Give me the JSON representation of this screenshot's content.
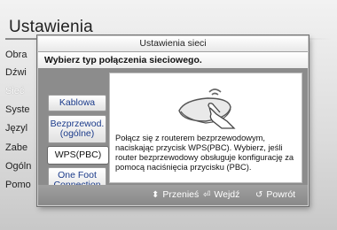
{
  "screen": {
    "title": "Ustawienia"
  },
  "side_menu": {
    "items": [
      {
        "label": "Obra"
      },
      {
        "label": "Dźwi"
      },
      {
        "label": "Sieć"
      },
      {
        "label": "Syste"
      },
      {
        "label": "Języl"
      },
      {
        "label": "Zabe"
      },
      {
        "label": "Ogóln"
      },
      {
        "label": "Pomo"
      }
    ],
    "active_index": 2
  },
  "dialog": {
    "header": "Ustawienia sieci",
    "subtitle": "Wybierz typ połączenia sieciowego.",
    "options": [
      {
        "label": "Kablowa",
        "selected": false
      },
      {
        "label": "Bezprzewod. (ogólne)",
        "selected": false
      },
      {
        "label": "WPS(PBC)",
        "selected": true
      },
      {
        "label": "One Foot Connection",
        "selected": false
      }
    ],
    "info_icon": "router-touch-icon",
    "info_text": "Połącz się z routerem bezprzewodowym, naciskając przycisk WPS(PBC). Wybierz, jeśli router bezprzewodowy obsługuje konfigurację za pomocą naciśnięcia przycisku (PBC).",
    "footer": {
      "move_label": "Przenieś",
      "enter_label": "Wejdź",
      "return_label": "Powrót"
    }
  },
  "colors": {
    "dialog_frame": "#8c8c8c",
    "option_text": "#1a3a8a",
    "selected_border": "#ffffff"
  }
}
